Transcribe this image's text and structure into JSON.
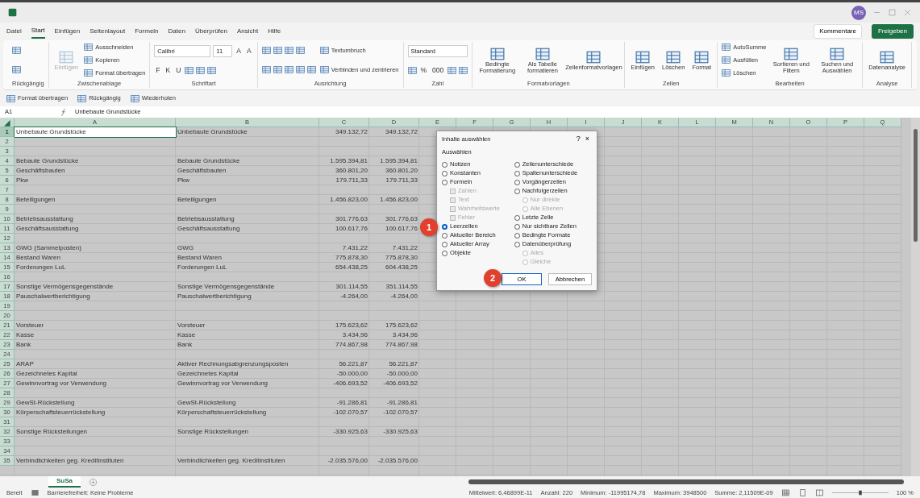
{
  "title_bar": {
    "avatar": "MS"
  },
  "ribbon_tabs": [
    {
      "label": "Datei",
      "selected": false
    },
    {
      "label": "Start",
      "selected": true
    },
    {
      "label": "Einfügen",
      "selected": false
    },
    {
      "label": "Seitenlayout",
      "selected": false
    },
    {
      "label": "Formeln",
      "selected": false
    },
    {
      "label": "Daten",
      "selected": false
    },
    {
      "label": "Überprüfen",
      "selected": false
    },
    {
      "label": "Ansicht",
      "selected": false
    },
    {
      "label": "Hilfe",
      "selected": false
    }
  ],
  "share": {
    "comments": "Kommentare",
    "share": "Freigeben"
  },
  "ribbon_groups": [
    {
      "label": "Rückgängig",
      "columns": [
        [
          {
            "kind": "icon"
          },
          {
            "kind": "icon"
          }
        ]
      ]
    },
    {
      "label": "Zwischenablage",
      "columns": [
        [
          {
            "kind": "large",
            "label": "Einfügen",
            "disabled": true
          }
        ],
        [
          {
            "kind": "small",
            "label": "Ausschneiden"
          },
          {
            "kind": "small",
            "label": "Kopieren"
          },
          {
            "kind": "small",
            "label": "Format übertragen"
          }
        ]
      ]
    },
    {
      "label": "Schriftart",
      "columns": [
        [
          {
            "kind": "row",
            "items": [
              {
                "kind": "combo",
                "value": "Calibri"
              },
              {
                "kind": "spin",
                "value": "11"
              },
              {
                "kind": "glyph",
                "label": "A"
              },
              {
                "kind": "glyph",
                "label": "A"
              }
            ]
          },
          {
            "kind": "row",
            "items": [
              {
                "kind": "glyph",
                "label": "F"
              },
              {
                "kind": "glyph",
                "label": "K"
              },
              {
                "kind": "glyph",
                "label": "U"
              },
              {
                "kind": "icon"
              },
              {
                "kind": "icon"
              },
              {
                "kind": "icon"
              }
            ]
          }
        ]
      ]
    },
    {
      "label": "Ausrichtung",
      "columns": [
        [
          {
            "kind": "row",
            "items": [
              {
                "kind": "icon"
              },
              {
                "kind": "icon"
              },
              {
                "kind": "icon"
              },
              {
                "kind": "icon"
              }
            ]
          },
          {
            "kind": "row",
            "items": [
              {
                "kind": "icon"
              },
              {
                "kind": "icon"
              },
              {
                "kind": "icon"
              },
              {
                "kind": "icon"
              },
              {
                "kind": "icon"
              }
            ]
          }
        ],
        [
          {
            "kind": "small",
            "label": "Textumbruch"
          },
          {
            "kind": "small",
            "label": "Verbinden und zentrieren"
          }
        ]
      ]
    },
    {
      "label": "Zahl",
      "columns": [
        [
          {
            "kind": "combo",
            "value": "Standard"
          },
          {
            "kind": "row",
            "items": [
              {
                "kind": "icon"
              },
              {
                "kind": "glyph",
                "label": "%"
              },
              {
                "kind": "glyph",
                "label": "000"
              },
              {
                "kind": "icon"
              },
              {
                "kind": "icon"
              }
            ]
          }
        ]
      ]
    },
    {
      "label": "Formatvorlagen",
      "columns": [
        [
          {
            "kind": "large",
            "label": "Bedingte Formatierung",
            "disabled": false
          }
        ],
        [
          {
            "kind": "large",
            "label": "Als Tabelle formatieren",
            "disabled": false
          }
        ],
        [
          {
            "kind": "large",
            "label": "Zellenformatvorlagen",
            "disabled": false
          }
        ]
      ]
    },
    {
      "label": "Zellen",
      "columns": [
        [
          {
            "kind": "large",
            "label": "Einfügen",
            "disabled": false
          }
        ],
        [
          {
            "kind": "large",
            "label": "Löschen",
            "disabled": false
          }
        ],
        [
          {
            "kind": "large",
            "label": "Format",
            "disabled": false
          }
        ]
      ]
    },
    {
      "label": "Bearbeiten",
      "columns": [
        [
          {
            "kind": "small",
            "label": "AutoSumme"
          },
          {
            "kind": "small",
            "label": "Ausfüllen"
          },
          {
            "kind": "small",
            "label": "Löschen"
          }
        ],
        [
          {
            "kind": "large",
            "label": "Sortieren und Filtern",
            "disabled": false
          }
        ],
        [
          {
            "kind": "large",
            "label": "Suchen und Auswählen",
            "disabled": false
          }
        ]
      ]
    },
    {
      "label": "Analyse",
      "columns": [
        [
          {
            "kind": "large",
            "label": "Datenanalyse",
            "disabled": false
          }
        ]
      ]
    }
  ],
  "quick_access": [
    "Format übertragen",
    "Rückgängig",
    "Wiederholen"
  ],
  "formula_bar": {
    "name_box": "A1",
    "formula": "Unbebaute Grundstücke"
  },
  "columns": [
    "A",
    "B",
    "C",
    "D",
    "E",
    "F",
    "G",
    "H",
    "I",
    "J",
    "K",
    "L",
    "M",
    "N",
    "O",
    "P",
    "Q"
  ],
  "rows": [
    {
      "number": "1",
      "selected": true,
      "a": "Unbebaute Grundstücke",
      "b": "Unbebaute Grundstücke",
      "c": "349.132,72",
      "d": "349.132,72"
    },
    {
      "number": "2",
      "selected": false
    },
    {
      "number": "3",
      "selected": false
    },
    {
      "number": "4",
      "selected": false,
      "a": "Bebaute Grundstücke",
      "b": "Bebaute Grundstücke",
      "c": "1.595.394,81",
      "d": "1.595.394,81"
    },
    {
      "number": "5",
      "selected": false,
      "a": "Geschäftsbauten",
      "b": "Geschäftsbauten",
      "c": "360.801,20",
      "d": "360.801,20"
    },
    {
      "number": "6",
      "selected": false,
      "a": "Pkw",
      "b": "Pkw",
      "c": "179.711,33",
      "d": "179.711,33"
    },
    {
      "number": "7",
      "selected": false
    },
    {
      "number": "8",
      "selected": false,
      "a": "Beteiligungen",
      "b": "Beteiligungen",
      "c": "1.456.823,00",
      "d": "1.456.823,00"
    },
    {
      "number": "9",
      "selected": false
    },
    {
      "number": "10",
      "selected": false,
      "a": "Betriebsausstattung",
      "b": "Betriebsausstattung",
      "c": "301.776,63",
      "d": "301.776,63"
    },
    {
      "number": "11",
      "selected": false,
      "a": "Geschäftsausstattung",
      "b": "Geschäftsausstattung",
      "c": "100.617,76",
      "d": "100.617,76"
    },
    {
      "number": "12",
      "selected": false
    },
    {
      "number": "13",
      "selected": false,
      "a": "GWG (Sammelposten)",
      "b": "GWG",
      "c": "7.431,22",
      "d": "7.431,22"
    },
    {
      "number": "14",
      "selected": false,
      "a": "Bestand Waren",
      "b": "Bestand Waren",
      "c": "775.878,30",
      "d": "775.878,30"
    },
    {
      "number": "15",
      "selected": false,
      "a": "Forderungen LuL",
      "b": "Forderungen LuL",
      "c": "654.438,25",
      "d": "604.438,25"
    },
    {
      "number": "16",
      "selected": false
    },
    {
      "number": "17",
      "selected": false,
      "a": "Sonstige Vermögensgegenstände",
      "b": "Sonstige Vermögensgegenstände",
      "c": "301.114,55",
      "d": "351.114,55"
    },
    {
      "number": "18",
      "selected": false,
      "a": "Pauschalwertberichtigung",
      "b": "Pauschalwertberichtigung",
      "c": "-4.264,00",
      "d": "-4.264,00"
    },
    {
      "number": "19",
      "selected": false
    },
    {
      "number": "20",
      "selected": false
    },
    {
      "number": "21",
      "selected": false,
      "a": "Vorsteuer",
      "b": "Vorsteuer",
      "c": "175.623,62",
      "d": "175.623,62"
    },
    {
      "number": "22",
      "selected": false,
      "a": "Kasse",
      "b": "Kasse",
      "c": "3.434,96",
      "d": "3.434,96"
    },
    {
      "number": "23",
      "selected": false,
      "a": "Bank",
      "b": "Bank",
      "c": "774.867,98",
      "d": "774.867,98"
    },
    {
      "number": "24",
      "selected": false
    },
    {
      "number": "25",
      "selected": false,
      "a": "ARAP",
      "b": "Aktiver Rechnungsabgrenzungsposten",
      "c": "56.221,87",
      "d": "56.221,87"
    },
    {
      "number": "26",
      "selected": false,
      "a": "Gezeichnetes Kapital",
      "b": "Gezeichnetes Kapital",
      "c": "-50.000,00",
      "d": "-50.000,00"
    },
    {
      "number": "27",
      "selected": false,
      "a": "Gewinnvortrag vor Verwendung",
      "b": "Gewinnvortrag vor Verwendung",
      "c": "-406.693,52",
      "d": "-406.693,52"
    },
    {
      "number": "28",
      "selected": false
    },
    {
      "number": "29",
      "selected": false,
      "a": "GewSt-Rückstellung",
      "b": "GewSt-Rückstellung",
      "c": "-91.286,81",
      "d": "-91.286,81"
    },
    {
      "number": "30",
      "selected": false,
      "a": "Körperschaftsteuerrückstellung",
      "b": "Körperschaftsteuerrückstellung",
      "c": "-102.070,57",
      "d": "-102.070,57"
    },
    {
      "number": "31",
      "selected": false
    },
    {
      "number": "32",
      "selected": false,
      "a": "Sonstige Rückstellungen",
      "b": "Sonstige Rückstellungen",
      "c": "-330.925,63",
      "d": "-330.925,63"
    },
    {
      "number": "33",
      "selected": false
    },
    {
      "number": "34",
      "selected": false
    },
    {
      "number": "35",
      "selected": false,
      "a": "Verbindlichkeiten geg. Kreditinstituten",
      "b": "Verbindlichkeiten geg. Kreditinstituten",
      "c": "-2.035.576,00",
      "d": "-2.035.576,00"
    }
  ],
  "dialog": {
    "title": "Inhalte auswählen",
    "help": "?",
    "close": "×",
    "group_label": "Auswählen",
    "left_options": [
      {
        "kind": "radio",
        "label": "Notizen",
        "selected": false,
        "disabled": false
      },
      {
        "kind": "radio",
        "label": "Konstanten",
        "selected": false,
        "disabled": false
      },
      {
        "kind": "radio",
        "label": "Formeln",
        "selected": false,
        "disabled": false,
        "children": [
          {
            "kind": "checkbox",
            "label": "Zahlen",
            "selected": false,
            "disabled": true
          },
          {
            "kind": "checkbox",
            "label": "Text",
            "selected": false,
            "disabled": true
          },
          {
            "kind": "checkbox",
            "label": "Wahrheitswerte",
            "selected": false,
            "disabled": true
          },
          {
            "kind": "checkbox",
            "label": "Fehler",
            "selected": false,
            "disabled": true
          }
        ]
      },
      {
        "kind": "radio",
        "label": "Leerzellen",
        "selected": true,
        "disabled": false
      },
      {
        "kind": "radio",
        "label": "Aktueller Bereich",
        "selected": false,
        "disabled": false
      },
      {
        "kind": "radio",
        "label": "Aktueller Array",
        "selected": false,
        "disabled": false
      },
      {
        "kind": "radio",
        "label": "Objekte",
        "selected": false,
        "disabled": false
      }
    ],
    "right_options": [
      {
        "kind": "radio",
        "label": "Zeilenunterschiede",
        "selected": false,
        "disabled": false
      },
      {
        "kind": "radio",
        "label": "Spaltenunterschiede",
        "selected": false,
        "disabled": false
      },
      {
        "kind": "radio",
        "label": "Vorgängerzellen",
        "selected": false,
        "disabled": false
      },
      {
        "kind": "radio",
        "label": "Nachfolgerzellen",
        "selected": false,
        "disabled": false,
        "children": [
          {
            "kind": "radio",
            "label": "Nur direkte",
            "selected": false,
            "disabled": true
          },
          {
            "kind": "radio",
            "label": "Alle Ebenen",
            "selected": false,
            "disabled": true
          }
        ]
      },
      {
        "kind": "radio",
        "label": "Letzte Zelle",
        "selected": false,
        "disabled": false
      },
      {
        "kind": "radio",
        "label": "Nur sichtbare Zellen",
        "selected": false,
        "disabled": false
      },
      {
        "kind": "radio",
        "label": "Bedingte Formate",
        "selected": false,
        "disabled": false
      },
      {
        "kind": "radio",
        "label": "Datenüberprüfung",
        "selected": false,
        "disabled": false,
        "children": [
          {
            "kind": "radio",
            "label": "Alles",
            "selected": false,
            "disabled": true
          },
          {
            "kind": "radio",
            "label": "Gleiche",
            "selected": false,
            "disabled": true
          }
        ]
      }
    ],
    "ok": "OK",
    "cancel": "Abbrechen"
  },
  "callouts": [
    "1",
    "2"
  ],
  "sheet_tabs": [
    {
      "label": "SuSa",
      "selected": true
    }
  ],
  "status_bar": {
    "ready": "Bereit",
    "accessibility": "Barrierefreiheit: Keine Probleme",
    "stats": [
      "Mittelwert: 6,46899E-11",
      "Anzahl: 220",
      "Minimum: -11995174,78",
      "Maximum: 3948500",
      "Summe: 2,11509E-09"
    ],
    "zoom": "100 %",
    "zoom_slider": {
      "level": 0.5
    }
  }
}
